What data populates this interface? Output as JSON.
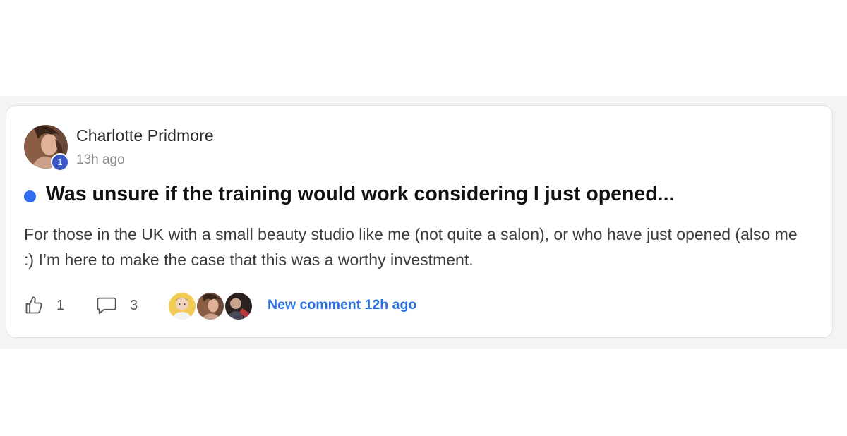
{
  "post": {
    "author": "Charlotte Pridmore",
    "timestamp": "13h ago",
    "level": "1",
    "title": "Was unsure if the training would work considering I just opened...",
    "body": "For those in the UK with a small beauty studio like me (not quite a salon), or who have just opened (also me :) I’m here to make the case that this was a worthy investment.",
    "unread": true
  },
  "actions": {
    "like_count": "1",
    "comment_count": "3",
    "last_activity": "New comment 12h ago"
  },
  "icons": {
    "like": "thumbs-up-icon",
    "comment": "comment-bubble-icon"
  },
  "colors": {
    "accent": "#2f6cf0",
    "link": "#2a6fe0",
    "level_badge": "#3a57c6"
  }
}
